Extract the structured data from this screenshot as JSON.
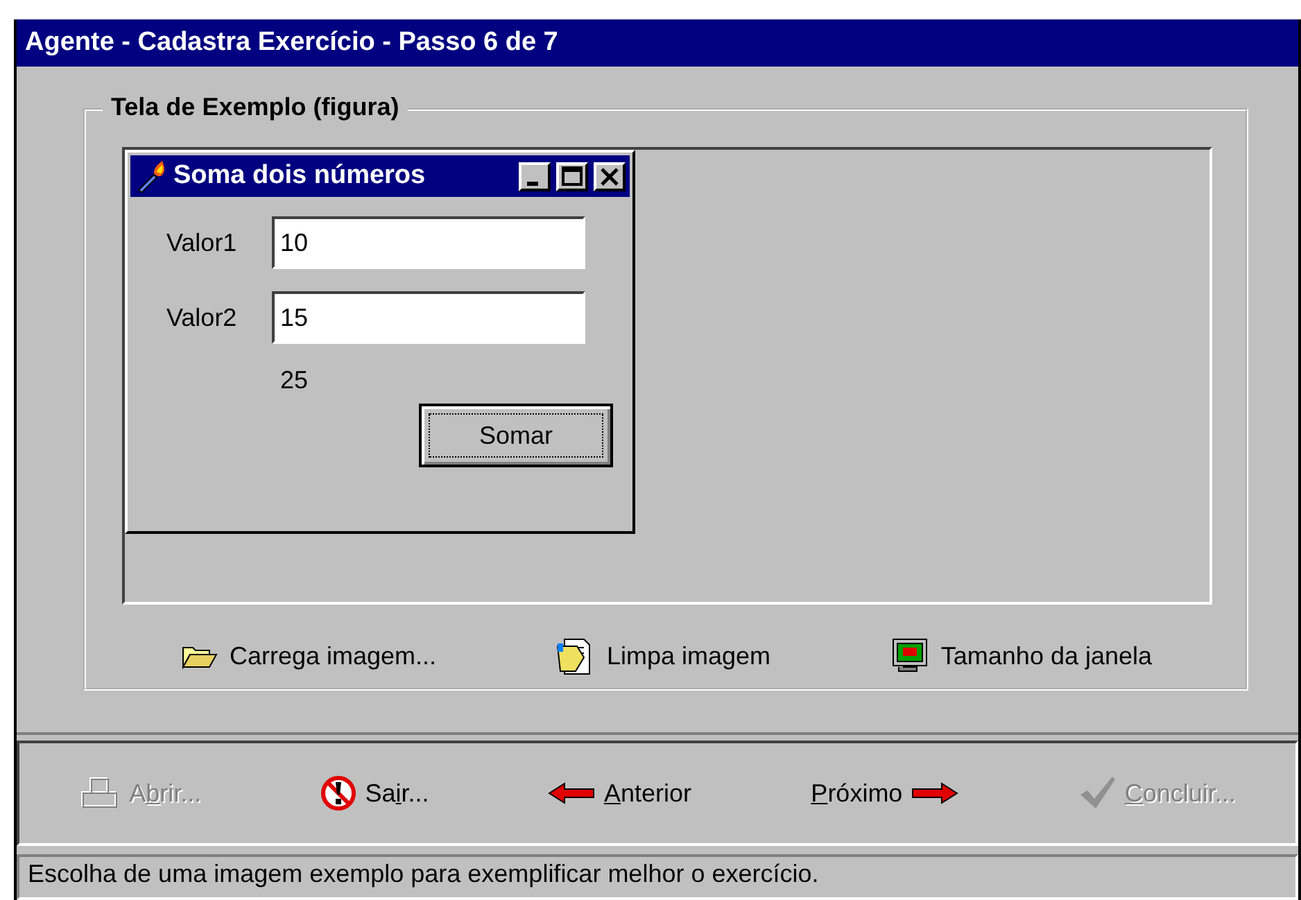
{
  "window": {
    "title": "Agente - Cadastra Exercício - Passo 6 de 7"
  },
  "example_group": {
    "title": "Tela de Exemplo (figura)",
    "preview_window": {
      "title": "Soma dois números",
      "fields": [
        {
          "label": "Valor1",
          "value": "10"
        },
        {
          "label": "Valor2",
          "value": "15"
        }
      ],
      "result": "25",
      "button": "Somar"
    },
    "image_actions": [
      {
        "kind": "open",
        "label": "Carrega imagem..."
      },
      {
        "kind": "clear",
        "label": "Limpa imagem"
      },
      {
        "kind": "size",
        "label": "Tamanho da janela"
      }
    ]
  },
  "wizard_buttons": [
    {
      "kind": "open",
      "before": "A",
      "key": "b",
      "after": "rir...",
      "disabled": true
    },
    {
      "kind": "exit",
      "before": "Sa",
      "key": "i",
      "after": "r...",
      "disabled": false
    },
    {
      "kind": "back",
      "key": "A",
      "after": "nterior",
      "disabled": false
    },
    {
      "kind": "next",
      "key": "P",
      "after": "róximo",
      "disabled": false
    },
    {
      "kind": "finish",
      "key": "C",
      "after": "oncluir...",
      "disabled": true
    }
  ],
  "status_bar": "Escolha de uma imagem exemplo para exemplificar melhor o exercício."
}
